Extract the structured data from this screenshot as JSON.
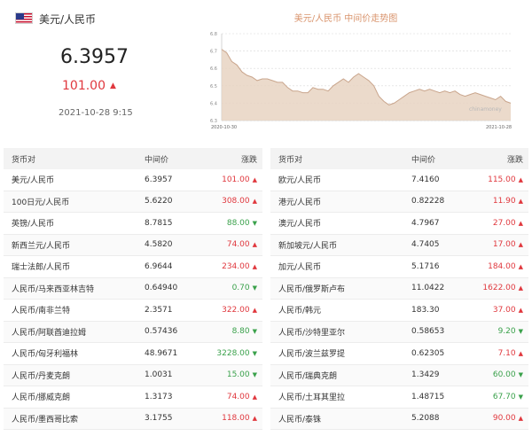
{
  "header": {
    "pair_title": "美元/人民币",
    "rate": "6.3957",
    "change": "101.00",
    "time": "2021-10-28 9:15"
  },
  "chart": {
    "title": "美元/人民币 中间价走势图",
    "watermark": "chinamoney",
    "line_color": "#c9a58c",
    "fill_color": "#e8d3c2",
    "chart_data": {
      "type": "area",
      "title": "美元/人民币 中间价走势图",
      "x_start": "2020-10-30",
      "x_end": "2021-10-28",
      "y_ticks": [
        "6.8",
        "6.7",
        "6.6",
        "6.5",
        "6.4",
        "6.3"
      ],
      "ylim": [
        6.3,
        6.8
      ],
      "grid": true,
      "values": [
        6.71,
        6.69,
        6.64,
        6.62,
        6.58,
        6.56,
        6.55,
        6.53,
        6.54,
        6.54,
        6.53,
        6.52,
        6.52,
        6.49,
        6.47,
        6.47,
        6.46,
        6.46,
        6.49,
        6.48,
        6.48,
        6.47,
        6.5,
        6.52,
        6.54,
        6.52,
        6.55,
        6.57,
        6.55,
        6.53,
        6.5,
        6.44,
        6.41,
        6.39,
        6.4,
        6.42,
        6.44,
        6.46,
        6.47,
        6.48,
        6.47,
        6.48,
        6.47,
        6.46,
        6.47,
        6.46,
        6.47,
        6.45,
        6.44,
        6.45,
        6.46,
        6.45,
        6.44,
        6.43,
        6.42,
        6.44,
        6.41,
        6.4
      ]
    }
  },
  "table_left": {
    "headers": [
      "货币对",
      "中间价",
      "涨跌"
    ],
    "rows": [
      {
        "pair": "美元/人民币",
        "price": "6.3957",
        "change": "101.00",
        "dir": "up"
      },
      {
        "pair": "100日元/人民币",
        "price": "5.6220",
        "change": "308.00",
        "dir": "up"
      },
      {
        "pair": "英镑/人民币",
        "price": "8.7815",
        "change": "88.00",
        "dir": "down"
      },
      {
        "pair": "新西兰元/人民币",
        "price": "4.5820",
        "change": "74.00",
        "dir": "up"
      },
      {
        "pair": "瑞士法郎/人民币",
        "price": "6.9644",
        "change": "234.00",
        "dir": "up"
      },
      {
        "pair": "人民币/马来西亚林吉特",
        "price": "0.64940",
        "change": "0.70",
        "dir": "down"
      },
      {
        "pair": "人民币/南非兰特",
        "price": "2.3571",
        "change": "322.00",
        "dir": "up"
      },
      {
        "pair": "人民币/阿联酋迪拉姆",
        "price": "0.57436",
        "change": "8.80",
        "dir": "down"
      },
      {
        "pair": "人民币/匈牙利福林",
        "price": "48.9671",
        "change": "3228.00",
        "dir": "down"
      },
      {
        "pair": "人民币/丹麦克朗",
        "price": "1.0031",
        "change": "15.00",
        "dir": "down"
      },
      {
        "pair": "人民币/挪威克朗",
        "price": "1.3173",
        "change": "74.00",
        "dir": "up"
      },
      {
        "pair": "人民币/墨西哥比索",
        "price": "3.1755",
        "change": "118.00",
        "dir": "up"
      }
    ]
  },
  "table_right": {
    "headers": [
      "货币对",
      "中间价",
      "涨跌"
    ],
    "rows": [
      {
        "pair": "欧元/人民币",
        "price": "7.4160",
        "change": "115.00",
        "dir": "up"
      },
      {
        "pair": "港元/人民币",
        "price": "0.82228",
        "change": "11.90",
        "dir": "up"
      },
      {
        "pair": "澳元/人民币",
        "price": "4.7967",
        "change": "27.00",
        "dir": "up"
      },
      {
        "pair": "新加坡元/人民币",
        "price": "4.7405",
        "change": "17.00",
        "dir": "up"
      },
      {
        "pair": "加元/人民币",
        "price": "5.1716",
        "change": "184.00",
        "dir": "up"
      },
      {
        "pair": "人民币/俄罗斯卢布",
        "price": "11.0422",
        "change": "1622.00",
        "dir": "up"
      },
      {
        "pair": "人民币/韩元",
        "price": "183.30",
        "change": "37.00",
        "dir": "up"
      },
      {
        "pair": "人民币/沙特里亚尔",
        "price": "0.58653",
        "change": "9.20",
        "dir": "down"
      },
      {
        "pair": "人民币/波兰兹罗提",
        "price": "0.62305",
        "change": "7.10",
        "dir": "up"
      },
      {
        "pair": "人民币/瑞典克朗",
        "price": "1.3429",
        "change": "60.00",
        "dir": "down"
      },
      {
        "pair": "人民币/土耳其里拉",
        "price": "1.48715",
        "change": "67.70",
        "dir": "down"
      },
      {
        "pair": "人民币/泰铢",
        "price": "5.2088",
        "change": "90.00",
        "dir": "up"
      }
    ]
  }
}
